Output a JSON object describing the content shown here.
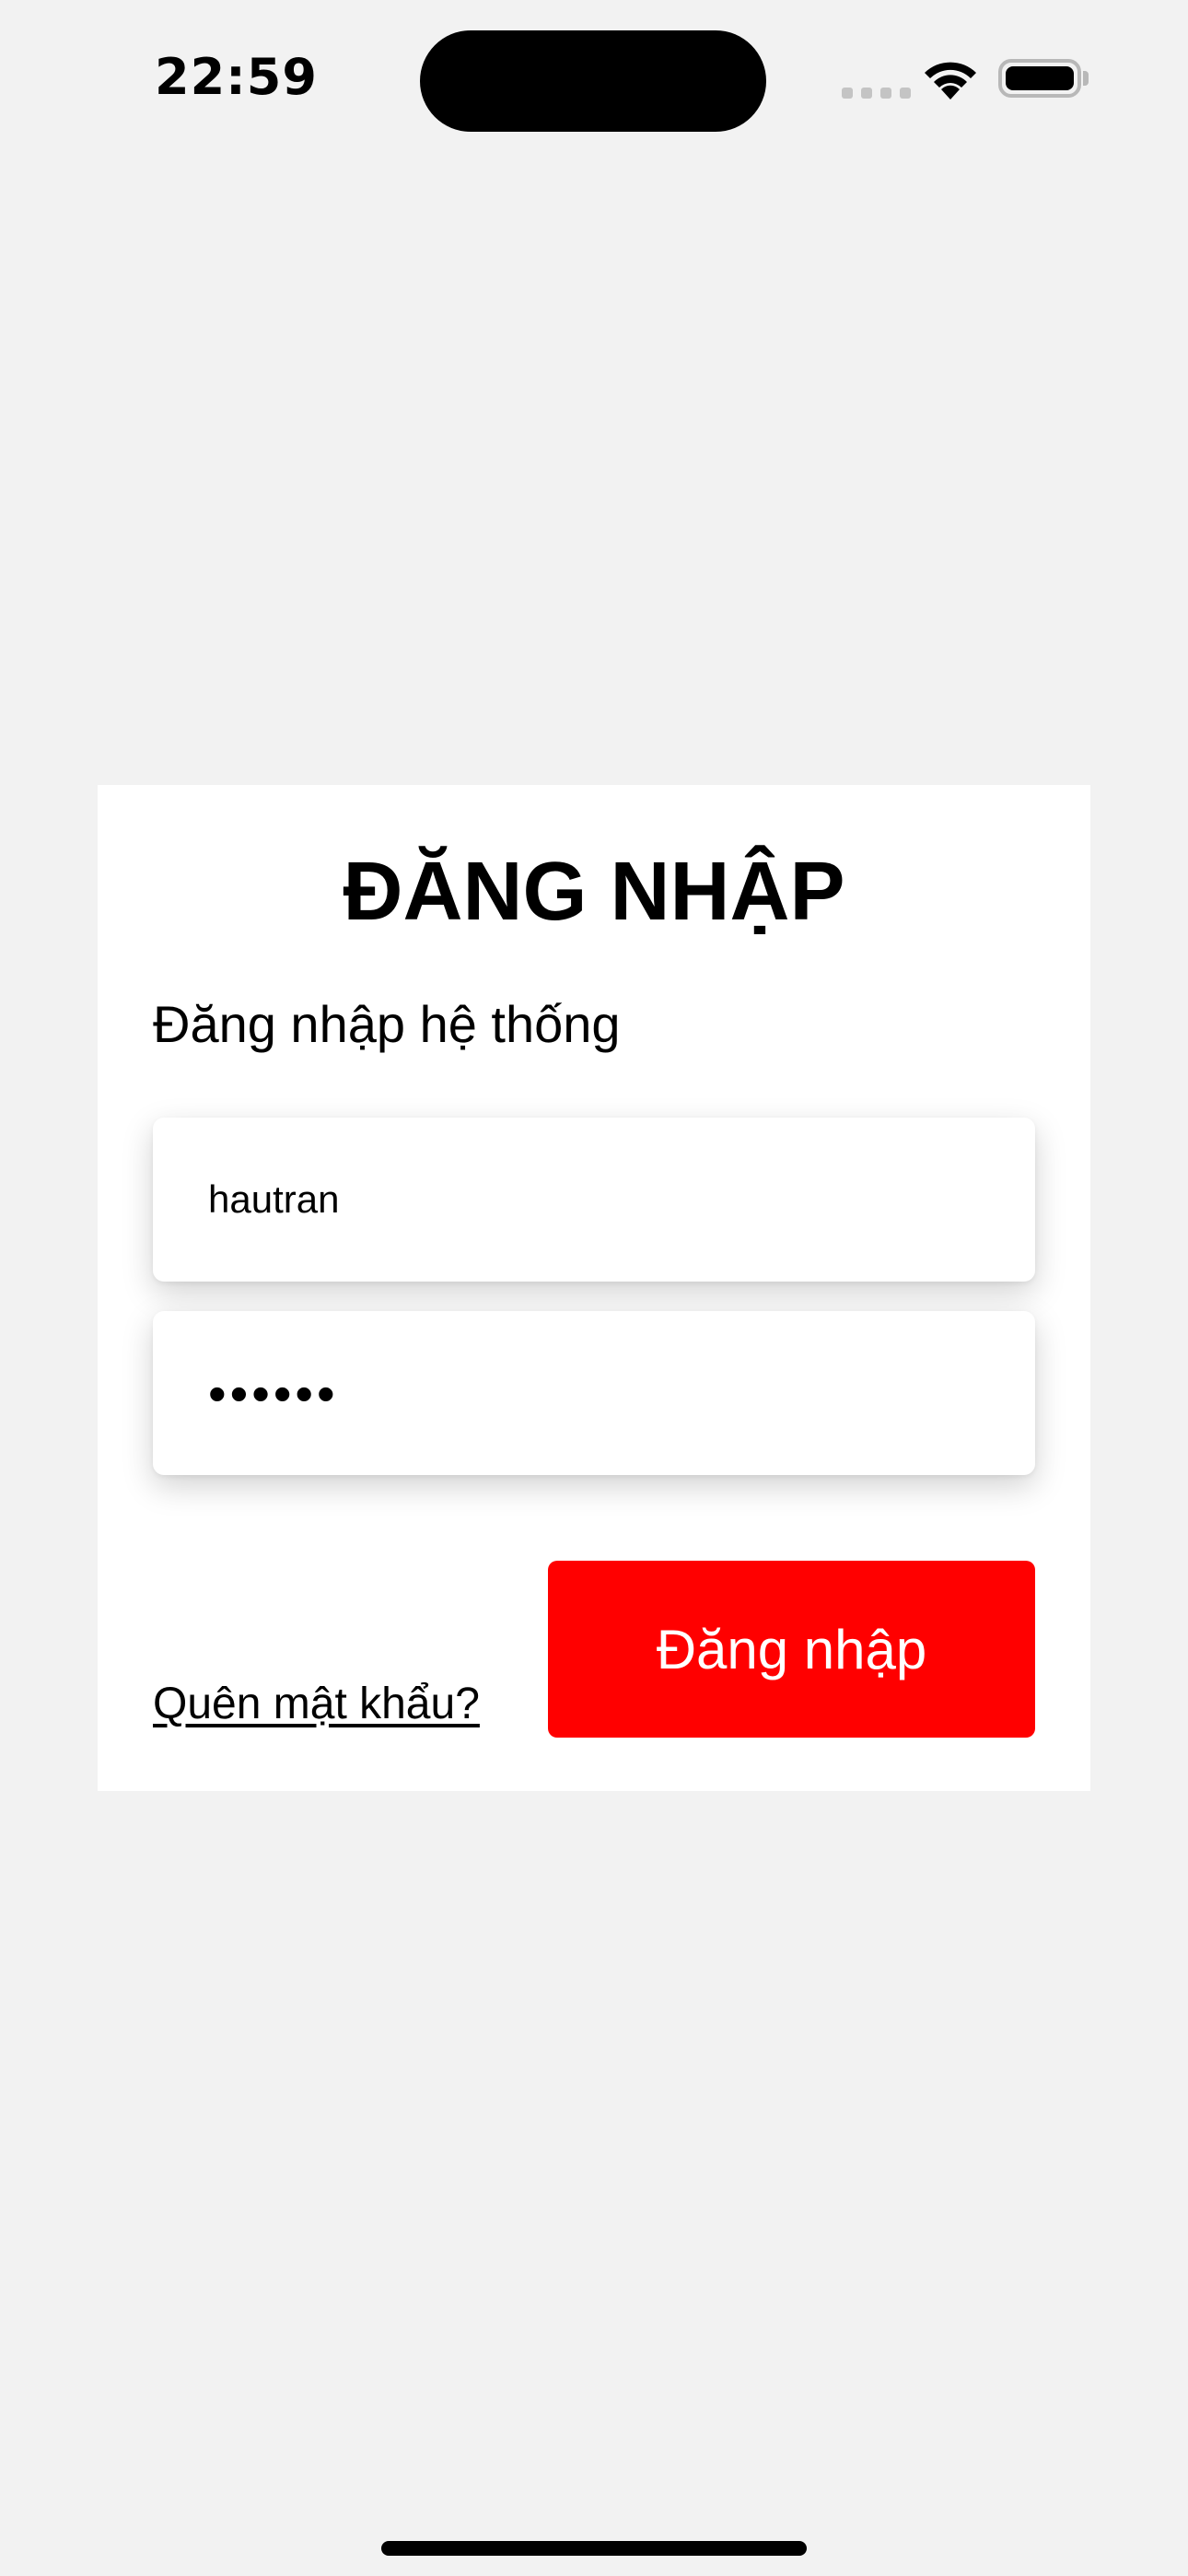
{
  "status_bar": {
    "time": "22:59",
    "icons": [
      "cellular-signal-icon",
      "wifi-icon",
      "battery-icon"
    ]
  },
  "login": {
    "title": "ĐĂNG NHẬP",
    "subtitle": "Đăng nhập hệ thống",
    "username_value": "hautran",
    "password_value": "••••••",
    "forgot_password_label": "Quên mật khẩu?",
    "submit_label": "Đăng nhập"
  },
  "colors": {
    "background": "#f2f2f2",
    "card": "#ffffff",
    "accent": "#ff0000"
  }
}
